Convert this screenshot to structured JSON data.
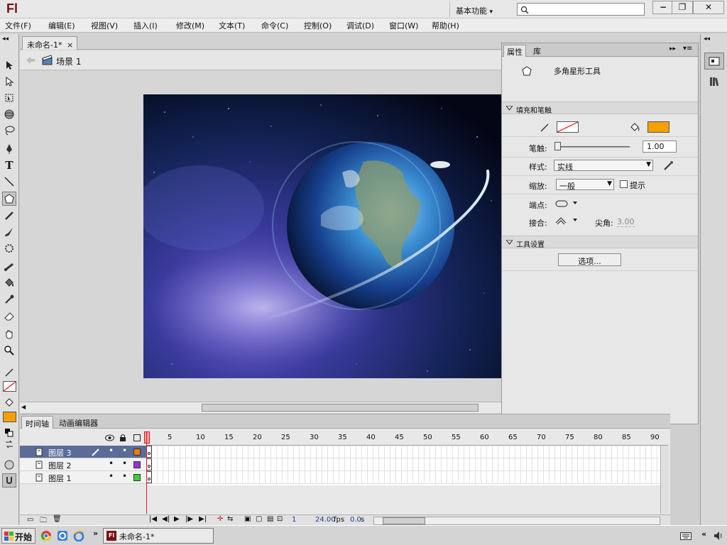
{
  "app": {
    "logo": "Fl",
    "workspace": "基本功能",
    "search_placeholder": ""
  },
  "window_controls": {
    "minimize": "−",
    "restore": "❐",
    "close": "✕"
  },
  "menu": [
    "文件(F)",
    "编辑(E)",
    "视图(V)",
    "插入(I)",
    "修改(M)",
    "文本(T)",
    "命令(C)",
    "控制(O)",
    "调试(D)",
    "窗口(W)",
    "帮助(H)"
  ],
  "document": {
    "tab": "未命名-1*",
    "tab_close": "×",
    "scene": "场景 1"
  },
  "properties": {
    "tabs": [
      "属性",
      "库"
    ],
    "tool_name": "多角星形工具",
    "section_fill": "填充和笔触",
    "stroke_color": "none",
    "fill_color": "#f5a000",
    "stroke_label": "笔触:",
    "stroke_value": "1.00",
    "stroke_value_fraction": 0.0,
    "style_label": "样式:",
    "style_value": "实线",
    "scale_label": "缩放:",
    "scale_value": "一般",
    "hint_label": "提示",
    "cap_label": "端点:",
    "join_label": "接合:",
    "miter_label": "尖角:",
    "miter_value": "3.00",
    "section_tool": "工具设置",
    "options_button": "选项..."
  },
  "timeline": {
    "tabs": [
      "时间轴",
      "动画编辑器"
    ],
    "ruler": [
      "1",
      "5",
      "10",
      "15",
      "20",
      "25",
      "30",
      "35",
      "40",
      "45",
      "50",
      "55",
      "60",
      "65",
      "70",
      "75",
      "80",
      "85",
      "90"
    ],
    "current_frame": "1",
    "fps": "24.00",
    "fps_unit": "fps",
    "time": "0.0",
    "time_unit": "s",
    "layers": [
      {
        "name": "图层 3",
        "color": "#f57a00",
        "selected": true
      },
      {
        "name": "图层 2",
        "color": "#9b2fd6",
        "selected": false
      },
      {
        "name": "图层 1",
        "color": "#3ad13a",
        "selected": false
      }
    ]
  },
  "taskbar": {
    "start": "开始",
    "task": "未命名-1*",
    "chevron": "»"
  }
}
